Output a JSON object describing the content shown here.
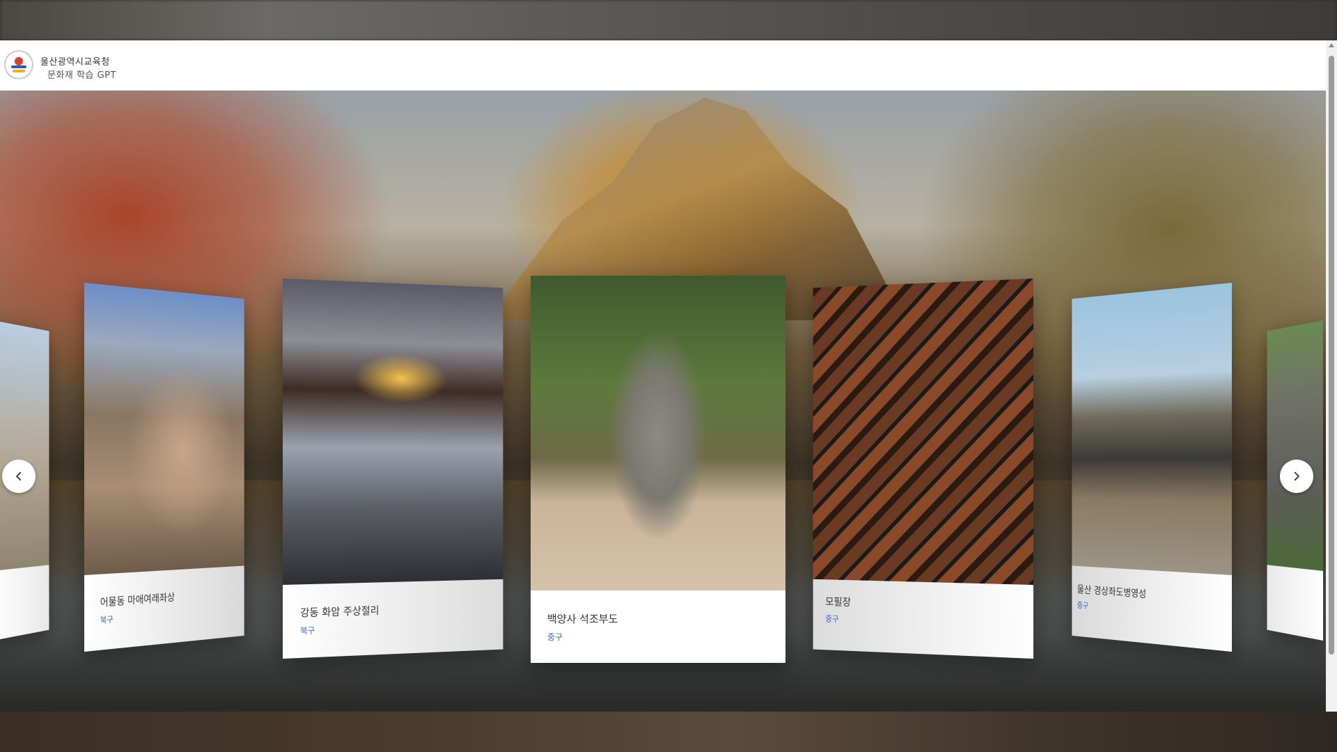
{
  "header": {
    "organization": "울산광역시교육청",
    "service": "문화재 학습 GPT"
  },
  "carousel": {
    "prev_icon": "chevron-left-icon",
    "next_icon": "chevron-right-icon",
    "cards": [
      {
        "title": "",
        "district": ""
      },
      {
        "title": "어물동 마애여래좌상",
        "district": "북구"
      },
      {
        "title": "강동 화암 주상절리",
        "district": "북구"
      },
      {
        "title": "백양사 석조부도",
        "district": "중구"
      },
      {
        "title": "모필장",
        "district": "중구"
      },
      {
        "title": "울산 경상좌도병영성",
        "district": "중구"
      },
      {
        "title": "",
        "district": ""
      }
    ]
  }
}
